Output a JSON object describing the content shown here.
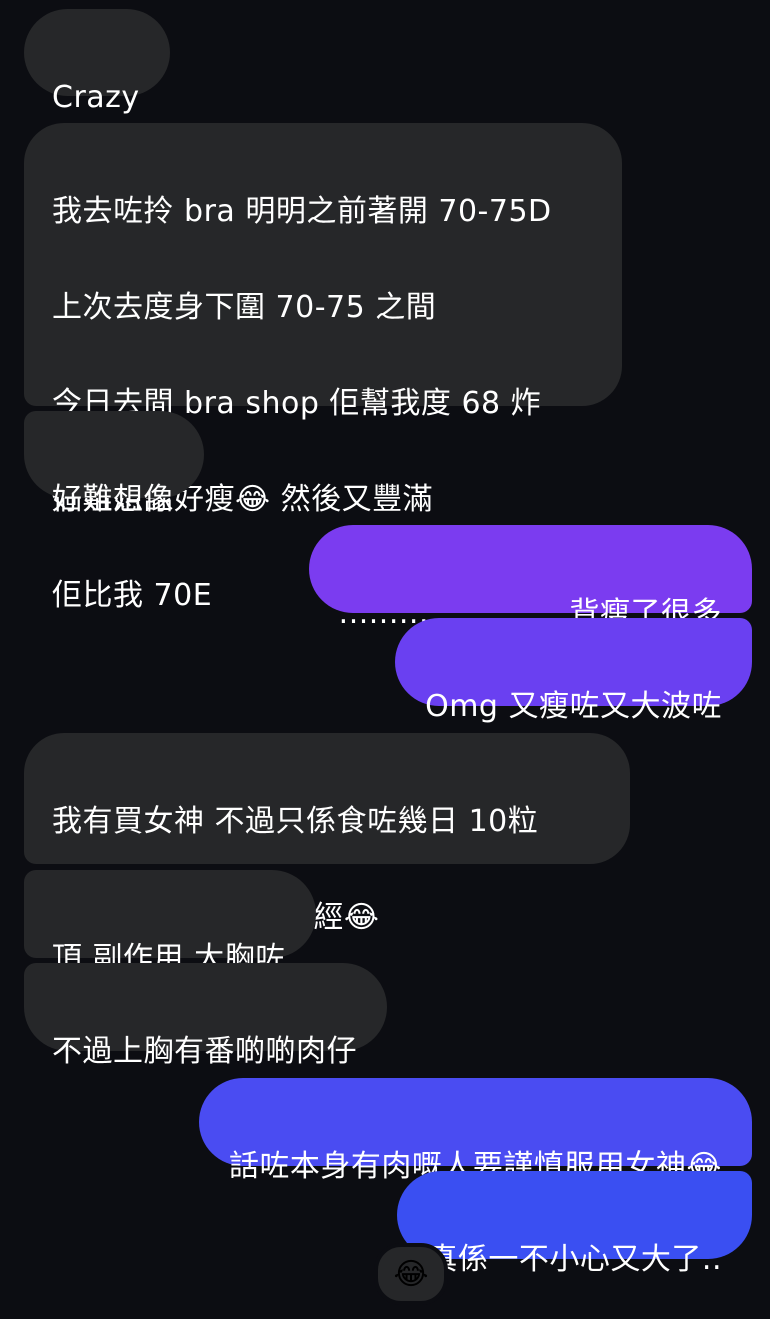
{
  "messages": [
    {
      "side": "in",
      "lines": [
        "Crazy"
      ]
    },
    {
      "side": "in",
      "lines": [
        "我去咗拎 bra 明明之前著開 70-75D",
        "上次去度身下圍 70-75 之間",
        "今日去間 bra shop 佢幫我度 68 炸",
        "個姐姐話好瘦😂 然後又豐滿",
        "佢比我 70E"
      ]
    },
    {
      "side": "in",
      "lines": [
        "好難想像"
      ]
    },
    {
      "side": "out",
      "lines": [
        ".......................背瘦了很多"
      ]
    },
    {
      "side": "out",
      "lines": [
        "Omg 又瘦咗又大波咗"
      ]
    },
    {
      "side": "in",
      "lines": [
        "我有買女神 不過只係食咗幾日 10粒",
        "之內🥹 我諗住催下經😂"
      ]
    },
    {
      "side": "in",
      "lines": [
        "頂 副作用 大胸咗"
      ]
    },
    {
      "side": "in",
      "lines": [
        "不過上胸有番啲啲肉仔"
      ]
    },
    {
      "side": "out",
      "lines": [
        "話咗本身有肉嘅人要謹慎服用女神😂"
      ]
    },
    {
      "side": "out",
      "lines": [
        "真係一不小心又大了.."
      ]
    }
  ],
  "reaction": "😂",
  "colors": {
    "background": "#0c0d12",
    "incoming_bubble": "#262729",
    "outgoing_gradient_top": "#7b3cf0",
    "outgoing_gradient_bottom": "#3a4ff2"
  }
}
